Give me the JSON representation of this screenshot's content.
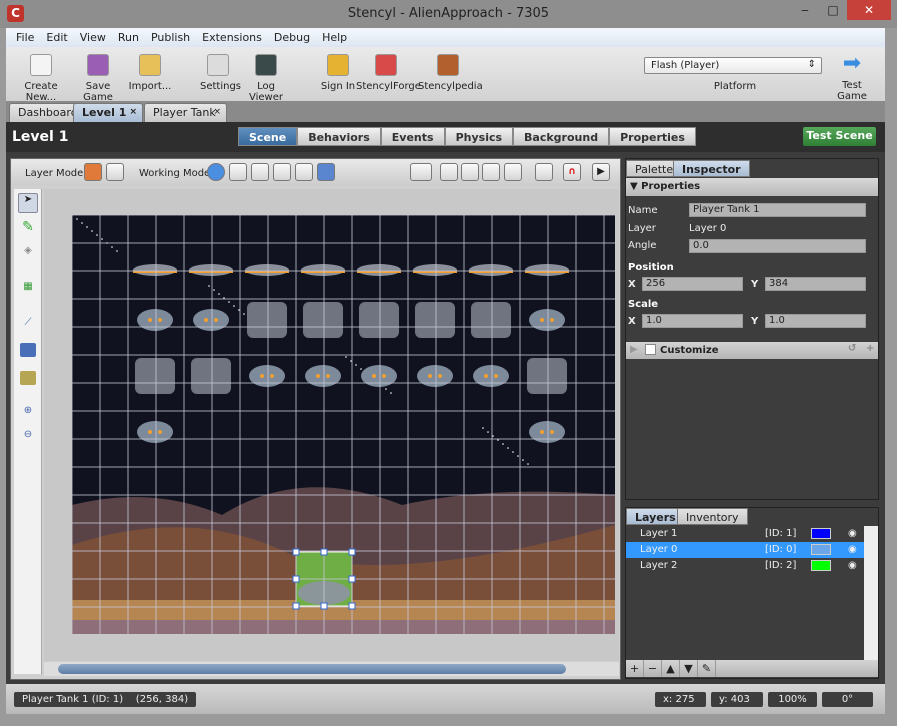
{
  "window": {
    "title": "Stencyl - AlienApproach - 7305",
    "app_icon": "C",
    "minimize": "‒",
    "maximize": "□",
    "close": "✕"
  },
  "menu": [
    "File",
    "Edit",
    "View",
    "Run",
    "Publish",
    "Extensions",
    "Debug",
    "Help"
  ],
  "toolbar": {
    "buttons": [
      {
        "label": "Create New...",
        "icon": "create-new-icon",
        "color": "#f4f4f4"
      },
      {
        "label": "Save Game",
        "icon": "floppy-icon",
        "color": "#9a5fb5"
      },
      {
        "label": "Import...",
        "icon": "import-icon",
        "color": "#e8c05a"
      },
      {
        "label": "Settings",
        "icon": "settings-icon",
        "color": "#dcdcdc"
      },
      {
        "label": "Log Viewer",
        "icon": "log-viewer-icon",
        "color": "#3a4a4a"
      },
      {
        "label": "Sign In",
        "icon": "key-icon",
        "color": "#e5b232"
      },
      {
        "label": "StencylForge",
        "icon": "store-icon",
        "color": "#d84a4a"
      },
      {
        "label": "Stencylpedia",
        "icon": "book-icon",
        "color": "#b2602e"
      }
    ],
    "platform": "Flash (Player)",
    "platform_label": "Platform",
    "test_game": "Test Game"
  },
  "doc_tabs": [
    {
      "label": "Dashboard"
    },
    {
      "label": "Level 1",
      "active": true,
      "close": "×"
    },
    {
      "label": "Player Tank",
      "close": "×"
    }
  ],
  "header": {
    "title": "Level 1",
    "tabs": [
      "Scene",
      "Behaviors",
      "Events",
      "Physics",
      "Background",
      "Properties"
    ],
    "active_tab": "Scene",
    "test_scene": "Test Scene"
  },
  "scene_toolbar": {
    "layer_mode": "Layer Mode",
    "working_mode": "Working Mode"
  },
  "inspector": {
    "tabs": [
      "Palette",
      "Inspector"
    ],
    "active_tab": "Inspector",
    "section": "▼ Properties",
    "name_label": "Name",
    "name": "Player Tank 1",
    "layer_label": "Layer",
    "layer": "Layer 0",
    "angle_label": "Angle",
    "angle": "0.0",
    "position_label": "Position",
    "x_label": "X",
    "y_label": "Y",
    "pos_x": "256",
    "pos_y": "384",
    "scale_label": "Scale",
    "scale_x": "1.0",
    "scale_y": "1.0",
    "customize": "Customize"
  },
  "layers": {
    "tabs": [
      "Layers",
      "Inventory"
    ],
    "active_tab": "Layers",
    "items": [
      {
        "name": "Layer 1",
        "id": "[ID: 1]",
        "color": "#0000ff",
        "selected": false
      },
      {
        "name": "Layer 0",
        "id": "[ID: 0]",
        "color": "#6aa6e8",
        "selected": true
      },
      {
        "name": "Layer 2",
        "id": "[ID: 2]",
        "color": "#00ff00",
        "selected": false
      }
    ],
    "buttons": [
      "+",
      "−",
      "▲",
      "▼",
      "✎"
    ]
  },
  "status": {
    "selection": "Player Tank 1 (ID: 1)    (256, 384)",
    "x": "x:   275",
    "y": "y:   403",
    "zoom": "100%",
    "angle": "0°"
  },
  "colors": {
    "accent": "#3399ff",
    "test_green": "#3f9444",
    "scene_bg": "#10131f"
  }
}
